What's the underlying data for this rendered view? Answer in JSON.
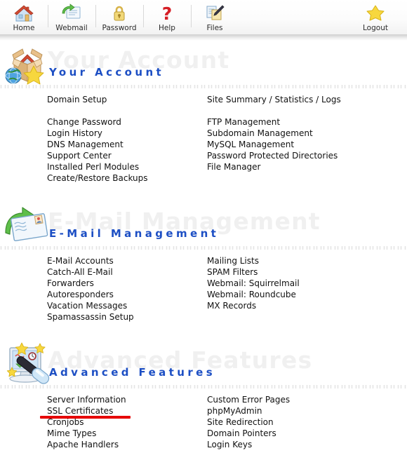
{
  "toolbar": {
    "items": [
      {
        "label": "Home",
        "icon": "house-icon"
      },
      {
        "label": "Webmail",
        "icon": "envelope-pencil-icon"
      },
      {
        "label": "Password",
        "icon": "padlock-icon"
      },
      {
        "label": "Help",
        "icon": "question-mark-icon"
      },
      {
        "label": "Files",
        "icon": "documents-pen-icon"
      }
    ],
    "logout": {
      "label": "Logout",
      "icon": "star-icon"
    }
  },
  "colors": {
    "section_title": "#1d4fc4",
    "watermark": "#f0f0f0",
    "link_text": "#111111",
    "annotation": "#e60000"
  },
  "sections": [
    {
      "title": "Your Account",
      "icon": "box-house-globe-star-icon",
      "left_column": [
        {
          "label": "Domain Setup",
          "gap_after": true
        },
        {
          "label": "Change Password"
        },
        {
          "label": "Login History"
        },
        {
          "label": "DNS Management"
        },
        {
          "label": "Support Center"
        },
        {
          "label": "Installed Perl Modules"
        },
        {
          "label": "Create/Restore Backups"
        }
      ],
      "right_column": [
        {
          "label": "Site Summary / Statistics / Logs",
          "gap_after": true
        },
        {
          "label": "FTP Management"
        },
        {
          "label": "Subdomain Management"
        },
        {
          "label": "MySQL Management"
        },
        {
          "label": "Password Protected Directories"
        },
        {
          "label": "File Manager"
        }
      ]
    },
    {
      "title": "E-Mail Management",
      "icon": "envelope-green-arrow-icon",
      "left_column": [
        {
          "label": "E-Mail Accounts"
        },
        {
          "label": "Catch-All E-Mail"
        },
        {
          "label": "Forwarders"
        },
        {
          "label": "Autoresponders"
        },
        {
          "label": "Vacation Messages"
        },
        {
          "label": "Spamassassin Setup"
        }
      ],
      "right_column": [
        {
          "label": "Mailing Lists"
        },
        {
          "label": "SPAM Filters"
        },
        {
          "label": "Webmail: Squirrelmail"
        },
        {
          "label": "Webmail: Roundcube"
        },
        {
          "label": "MX Records"
        }
      ]
    },
    {
      "title": "Advanced Features",
      "icon": "monitor-wand-stars-icon",
      "left_column": [
        {
          "label": "Server Information"
        },
        {
          "label": "SSL Certificates",
          "annotated": true
        },
        {
          "label": "Cronjobs"
        },
        {
          "label": "Mime Types"
        },
        {
          "label": "Apache Handlers"
        }
      ],
      "right_column": [
        {
          "label": "Custom Error Pages"
        },
        {
          "label": "phpMyAdmin"
        },
        {
          "label": "Site Redirection"
        },
        {
          "label": "Domain Pointers"
        },
        {
          "label": "Login Keys"
        }
      ]
    }
  ]
}
